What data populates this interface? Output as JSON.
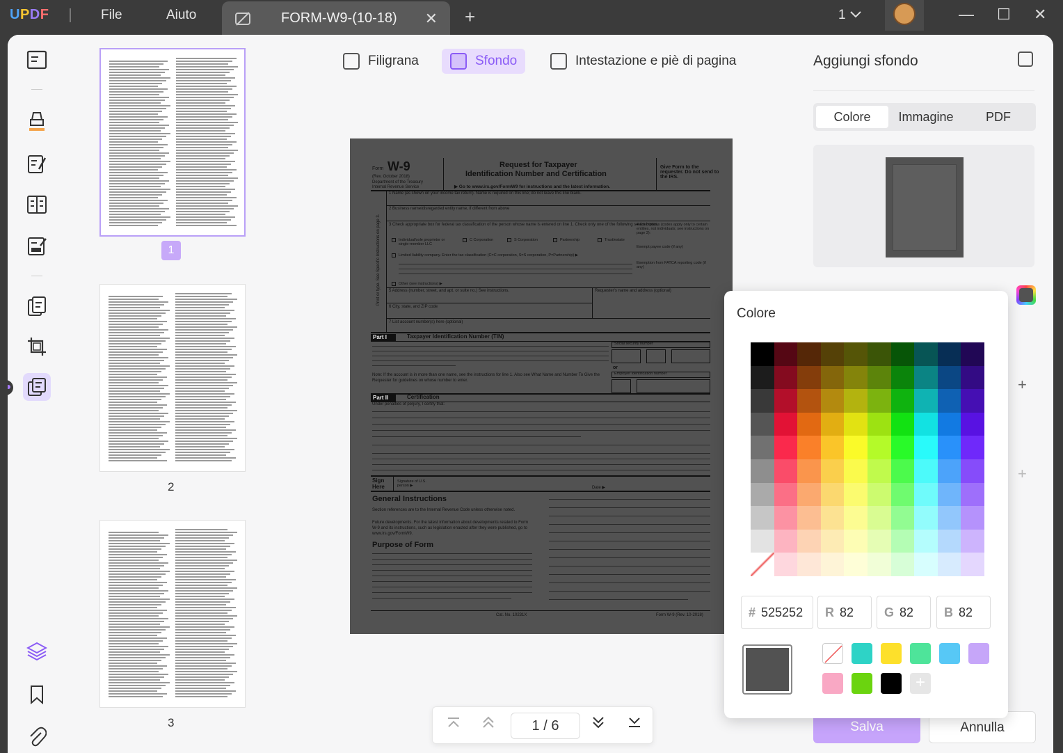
{
  "titlebar": {
    "logo": "UPDF",
    "menu": [
      "File",
      "Aiuto"
    ],
    "tab_title": "FORM-W9-(10-18)",
    "page_count": "1"
  },
  "thumbnails": [
    {
      "num": "1",
      "selected": true
    },
    {
      "num": "2",
      "selected": false
    },
    {
      "num": "3",
      "selected": false
    }
  ],
  "toolbar": {
    "filigrana": "Filigrana",
    "sfondo": "Sfondo",
    "intestazione": "Intestazione e piè di pagina"
  },
  "document": {
    "form": "Form",
    "w9": "W-9",
    "rev": "(Rev. October 2018)",
    "dept": "Department of the Treasury",
    "irs": "Internal Revenue Service",
    "title1": "Request for Taxpayer",
    "title2": "Identification Number and Certification",
    "goto": "▶ Go to www.irs.gov/FormW9 for instructions and the latest information.",
    "give": "Give Form to the requester. Do not send to the IRS.",
    "l1": "1  Name (as shown on your income tax return). Name is required on this line; do not leave this line blank.",
    "l2": "2  Business name/disregarded entity name, if different from above",
    "l3": "3  Check appropriate box for federal tax classification of the person whose name is entered on line 1. Check only one of the following seven boxes.",
    "l4": "4  Exemptions (codes apply only to certain entities, not individuals; see instructions on page 3):",
    "c_ind": "Individual/sole proprietor or single-member LLC",
    "c_c": "C Corporation",
    "c_s": "S Corporation",
    "c_p": "Partnership",
    "c_t": "Trust/estate",
    "llc": "Limited liability company. Enter the tax classification (C=C corporation, S=S corporation, P=Partnership) ▶",
    "exempt_payee": "Exempt payee code (if any)",
    "fatca": "Exemption from FATCA reporting code (if any)",
    "other": "Other (see instructions) ▶",
    "l5": "5  Address (number, street, and apt. or suite no.) See instructions.",
    "requester": "Requester's name and address (optional)",
    "l6": "6  City, state, and ZIP code",
    "l7": "7  List account number(s) here (optional)",
    "side": "Print or type. See Specific Instructions on page 3.",
    "part1": "Part I",
    "part1_title": "Taxpayer Identification Number (TIN)",
    "ssn": "Social security number",
    "ein": "Employer identification number",
    "or": "or",
    "note": "Note: If the account is in more than one name, see the instructions for line 1. Also see What Name and Number To Give the Requester for guidelines on whose number to enter.",
    "part2": "Part II",
    "part2_title": "Certification",
    "perjury": "Under penalties of perjury, I certify that:",
    "sign": "Sign Here",
    "sig_of": "Signature of U.S. person ▶",
    "date": "Date ▶",
    "gi": "General Instructions",
    "gi_text": "Section references are to the Internal Revenue Code unless otherwise noted.",
    "future": "Future developments. For the latest information about developments related to Form W-9 and its instructions, such as legislation enacted after they were published, go to www.irs.gov/FormW9.",
    "purpose": "Purpose of Form",
    "cat": "Cat. No. 10231X",
    "footer": "Form W-9 (Rev. 10-2018)"
  },
  "pager": {
    "current": "1 / 6"
  },
  "right_panel": {
    "title": "Aggiungi sfondo",
    "tabs": [
      "Colore",
      "Immagine",
      "PDF"
    ],
    "save": "Salva",
    "cancel": "Annulla"
  },
  "color_popup": {
    "title": "Colore",
    "hex_label": "#",
    "hex": "525252",
    "r_label": "R",
    "r": "82",
    "g_label": "G",
    "g": "82",
    "b_label": "B",
    "b": "82",
    "current_color": "#525252",
    "presets": [
      "none",
      "#2ed3c6",
      "#fde02b",
      "#4ee49a",
      "#57c8f6",
      "#c6a6f9",
      "#f9a8c4",
      "#6bd40f",
      "#000000",
      "add"
    ]
  }
}
